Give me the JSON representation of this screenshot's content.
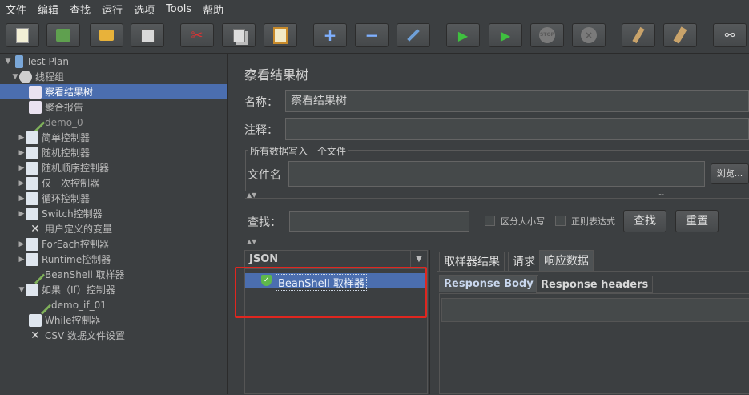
{
  "menu": [
    "文件",
    "编辑",
    "查找",
    "运行",
    "选项",
    "Tools",
    "帮助"
  ],
  "toolbar": {
    "buttons": [
      "new-icon",
      "templates-icon",
      "open-icon",
      "save-icon",
      "cut-icon",
      "copy-icon",
      "paste-icon",
      "expand-icon",
      "collapse-icon",
      "toggle-icon",
      "start-icon",
      "start-no-timers-icon",
      "stop-icon",
      "shutdown-icon",
      "clear-icon",
      "clear-all-icon",
      "search-icon"
    ],
    "expand_label": "+",
    "collapse_label": "−",
    "stop_label": "STOP"
  },
  "tree": {
    "items": [
      {
        "label": "Test Plan",
        "icon": "test-plan-icon",
        "arrow": "▼"
      },
      {
        "label": "线程组",
        "icon": "thread-group-icon",
        "arrow": "▼"
      },
      {
        "label": "察看结果树",
        "icon": "chart-icon",
        "arrow": ""
      },
      {
        "label": "聚合报告",
        "icon": "chart-icon",
        "arrow": ""
      },
      {
        "label": "demo_0",
        "icon": "sampler-icon",
        "arrow": ""
      },
      {
        "label": "简单控制器",
        "icon": "controller-icon",
        "arrow": "▶"
      },
      {
        "label": "随机控制器",
        "icon": "controller-icon",
        "arrow": "▶"
      },
      {
        "label": "随机顺序控制器",
        "icon": "controller-icon",
        "arrow": "▶"
      },
      {
        "label": "仅一次控制器",
        "icon": "controller-icon",
        "arrow": "▶"
      },
      {
        "label": "循环控制器",
        "icon": "controller-icon",
        "arrow": "▶"
      },
      {
        "label": "Switch控制器",
        "icon": "controller-icon",
        "arrow": "▶"
      },
      {
        "label": "用户定义的变量",
        "icon": "config-icon",
        "arrow": ""
      },
      {
        "label": "ForEach控制器",
        "icon": "controller-icon",
        "arrow": "▶"
      },
      {
        "label": "Runtime控制器",
        "icon": "controller-icon",
        "arrow": "▶"
      },
      {
        "label": "BeanShell 取样器",
        "icon": "sampler-icon",
        "arrow": ""
      },
      {
        "label": "如果（If）控制器",
        "icon": "controller-icon",
        "arrow": "▼"
      },
      {
        "label": "demo_if_01",
        "icon": "sampler-icon",
        "arrow": ""
      },
      {
        "label": "While控制器",
        "icon": "controller-icon",
        "arrow": ""
      },
      {
        "label": "CSV 数据文件设置",
        "icon": "config-icon",
        "arrow": ""
      }
    ]
  },
  "panel": {
    "title": "察看结果树",
    "name_label": "名称：",
    "name_value": "察看结果树",
    "comment_label": "注释：",
    "comment_value": "",
    "file_group_title": "所有数据写入一个文件",
    "filename_label": "文件名",
    "filename_value": "",
    "browse_label": "浏览...",
    "search_label": "查找：",
    "search_value": "",
    "case_sensitive_label": "区分大小写",
    "regex_label": "正则表达式",
    "find_button": "查找",
    "reset_button": "重置"
  },
  "results": {
    "renderer": "JSON",
    "items": [
      {
        "label": "BeanShell 取样器",
        "status": "success-icon"
      }
    ]
  },
  "tabs": {
    "sampler_result": "取样器结果",
    "request": "请求",
    "response_data": "响应数据",
    "response_body": "Response Body",
    "response_headers": "Response headers"
  },
  "colors": {
    "selection": "#4b6eaf",
    "highlight_box": "#e0261f",
    "background": "#3c3f41"
  }
}
